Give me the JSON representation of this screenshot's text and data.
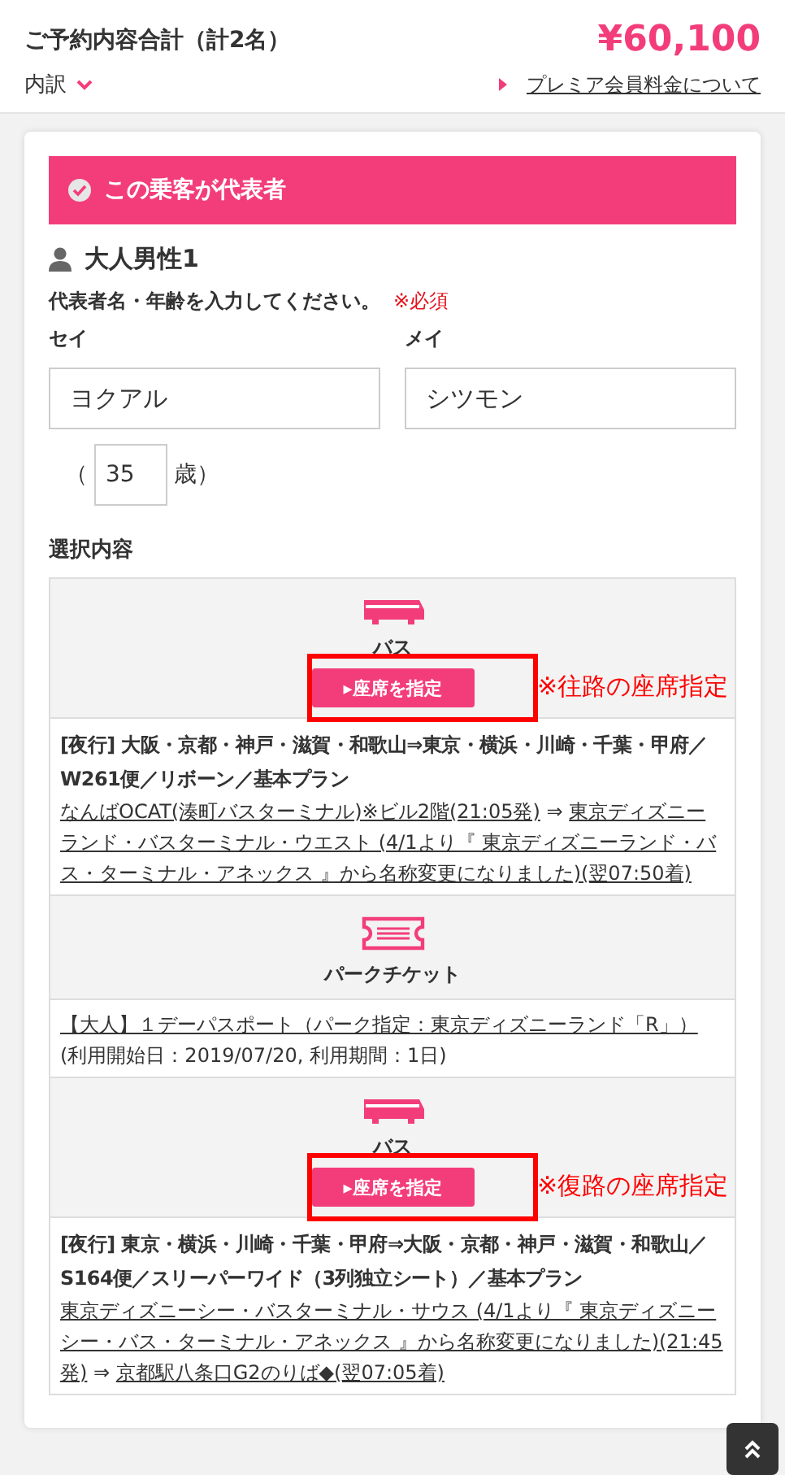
{
  "summary": {
    "title": "ご予約内容合計（計2名）",
    "total": "¥60,100",
    "breakdown_label": "内訳",
    "premium_link": "プレミア会員料金について"
  },
  "passenger": {
    "representative_banner": "この乗客が代表者",
    "representative": true,
    "name": "大人男性1",
    "instruction": "代表者名・年齢を入力してください。",
    "required": "※必須",
    "fields": [
      {
        "label": "セイ",
        "value": "ヨクアル"
      },
      {
        "label": "メイ",
        "value": "シツモン"
      }
    ],
    "age": {
      "open": "（",
      "value": "35",
      "close": "歳）"
    }
  },
  "selection": {
    "heading": "選択内容",
    "items": [
      {
        "kind": "bus",
        "label": "バス",
        "button": "▸座席を指定",
        "annotation": "※往路の座席指定",
        "title": "[夜行] 大阪・京都・神戸・滋賀・和歌山⇒東京・横浜・川崎・千葉・甲府／W261便／リボーン／基本プラン",
        "route": [
          {
            "text": "なんばOCAT(湊町バスターミナル)※ビル2階(21:05発)",
            "link": true
          },
          {
            "text": " ⇒ ",
            "link": false
          },
          {
            "text": "東京ディズニーランド・バスターミナル・ウエスト (4/1より『 東京ディズニーランド・バス・ターミナル・アネックス 』から名称変更になりました)(翌07:50着)",
            "link": true
          }
        ]
      },
      {
        "kind": "ticket",
        "label": "パークチケット",
        "title": "【大人】１デーパスポート（パーク指定：東京ディズニーランド「R」）",
        "note": "(利用開始日：2019/07/20, 利用期間：1日)"
      },
      {
        "kind": "bus",
        "label": "バス",
        "button": "▸座席を指定",
        "annotation": "※復路の座席指定",
        "title": "[夜行] 東京・横浜・川崎・千葉・甲府⇒大阪・京都・神戸・滋賀・和歌山／S164便／スリーパーワイド（3列独立シート）／基本プラン",
        "route": [
          {
            "text": "東京ディズニーシー・バスターミナル・サウス (4/1より『 東京ディズニーシー・バス・ターミナル・アネックス 』から名称変更になりました)(21:45発)",
            "link": true
          },
          {
            "text": " ⇒ ",
            "link": false
          },
          {
            "text": "京都駅八条口G2のりば◆(翌07:05着)",
            "link": true
          }
        ]
      }
    ]
  }
}
